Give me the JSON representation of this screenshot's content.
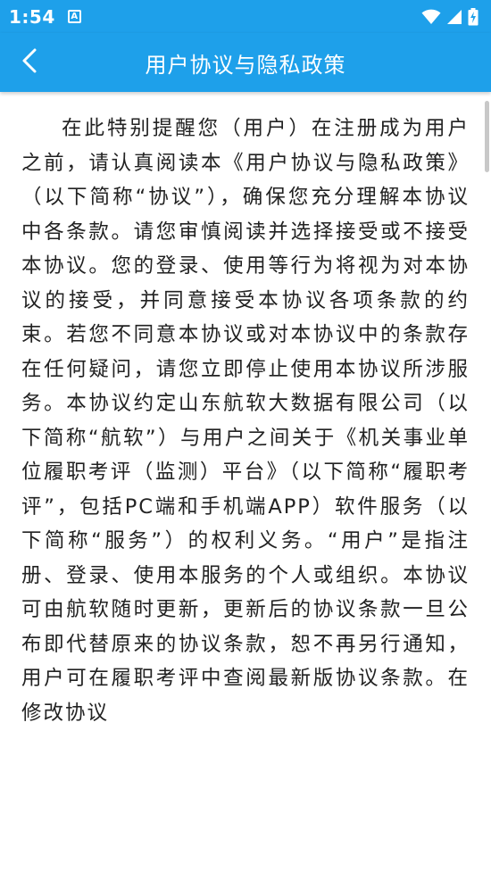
{
  "theme": {
    "brand": "#1ea0ea",
    "text": "#222222"
  },
  "status_bar": {
    "time": "1:54",
    "notification_glyph": "A",
    "icons": [
      "wifi-icon",
      "signal-icon",
      "battery-charging-icon"
    ]
  },
  "app_bar": {
    "title": "用户协议与隐私政策",
    "back_icon": "chevron-left-icon"
  },
  "agreement": {
    "body": "在此特别提醒您（用户）在注册成为用户之前，请认真阅读本《用户协议与隐私政策》（以下简称“协议”），确保您充分理解本协议中各条款。请您审慎阅读并选择接受或不接受本协议。您的登录、使用等行为将视为对本协议的接受，并同意接受本协议各项条款的约束。若您不同意本协议或对本协议中的条款存在任何疑问，请您立即停止使用本协议所涉服务。本协议约定山东航软大数据有限公司（以下简称“航软”）与用户之间关于《机关事业单位履职考评（监测）平台》（以下简称“履职考评”，包括PC端和手机端APP）软件服务（以下简称“服务”）的权利义务。“用户”是指注册、登录、使用本服务的个人或组织。本协议可由航软随时更新，更新后的协议条款一旦公布即代替原来的协议条款，恕不再另行通知，用户可在履职考评中查阅最新版协议条款。在修改协议"
  }
}
